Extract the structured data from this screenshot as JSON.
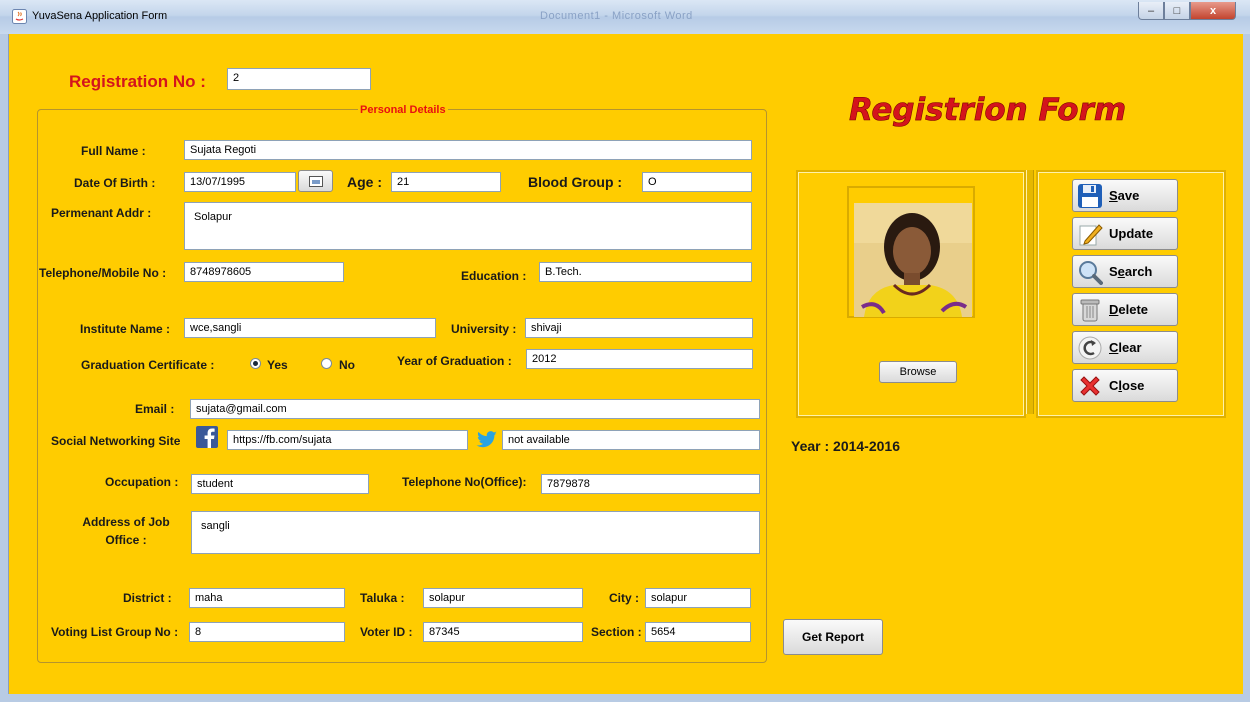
{
  "window": {
    "title": "YuvaSena Application Form",
    "background_title": "Document1 - Microsoft Word",
    "minimize": "–",
    "maximize": "□",
    "close": "x"
  },
  "colors": {
    "background": "#ffcc00",
    "accent_red": "#e81010",
    "heading": "#d4141c"
  },
  "registration": {
    "label": "Registration No :",
    "value": "2"
  },
  "heading": "Registrion Form",
  "personal_details": {
    "legend": "Personal Details",
    "full_name": {
      "label": "Full Name :",
      "value": "Sujata Regoti"
    },
    "dob": {
      "label": "Date Of Birth :",
      "value": "13/07/1995"
    },
    "age": {
      "label": "Age :",
      "value": "21"
    },
    "blood_group": {
      "label": "Blood Group :",
      "value": "O"
    },
    "permanent_addr": {
      "label": "Permenant Addr  :",
      "value": "Solapur"
    },
    "telephone": {
      "label": "Telephone/Mobile No :",
      "value": "8748978605"
    },
    "education": {
      "label": "Education :",
      "value": "B.Tech."
    },
    "institute": {
      "label": "Institute Name :",
      "value": "wce,sangli"
    },
    "university": {
      "label": "University :",
      "value": "shivaji"
    },
    "graduation_certificate": {
      "label": "Graduation Certificate :",
      "yes": "Yes",
      "no": "No",
      "selected": "Yes"
    },
    "year_of_graduation": {
      "label": "Year of Graduation :",
      "value": "2012"
    },
    "email": {
      "label": "Email :",
      "value": "sujata@gmail.com"
    },
    "social": {
      "label": "Social Networking Site",
      "facebook": "https://fb.com/sujata",
      "twitter": "not available"
    },
    "occupation": {
      "label": "Occupation :",
      "value": "student"
    },
    "telephone_office": {
      "label": "Telephone No(Office):",
      "value": "7879878"
    },
    "job_address": {
      "label_line1": "Address of Job",
      "label_line2": "Office :",
      "value": "sangli"
    },
    "district": {
      "label": "District :",
      "value": "maha"
    },
    "taluka": {
      "label": "Taluka :",
      "value": "solapur"
    },
    "city": {
      "label": "City :",
      "value": "solapur"
    },
    "voting_group": {
      "label": "Voting List Group No :",
      "value": "8"
    },
    "voter_id": {
      "label": "Voter ID :",
      "value": "87345"
    },
    "section": {
      "label": "Section :",
      "value": "5654"
    }
  },
  "photo": {
    "browse_label": "Browse"
  },
  "actions": {
    "save": {
      "mnemonic": "S",
      "rest": "ave",
      "icon": "floppy-disk-icon"
    },
    "update": {
      "label": "Update",
      "icon": "pencil-edit-icon"
    },
    "search": {
      "pre": "S",
      "mnemonic": "e",
      "rest": "arch",
      "icon": "magnifier-icon"
    },
    "delete": {
      "mnemonic": "D",
      "rest": "elete",
      "icon": "trash-can-icon"
    },
    "clear": {
      "mnemonic": "C",
      "rest": "lear",
      "icon": "undo-arrow-icon"
    },
    "close": {
      "pre": "C",
      "mnemonic": "l",
      "rest": "ose",
      "icon": "red-x-icon"
    }
  },
  "year": "Year : 2014-2016",
  "get_report": "Get Report"
}
